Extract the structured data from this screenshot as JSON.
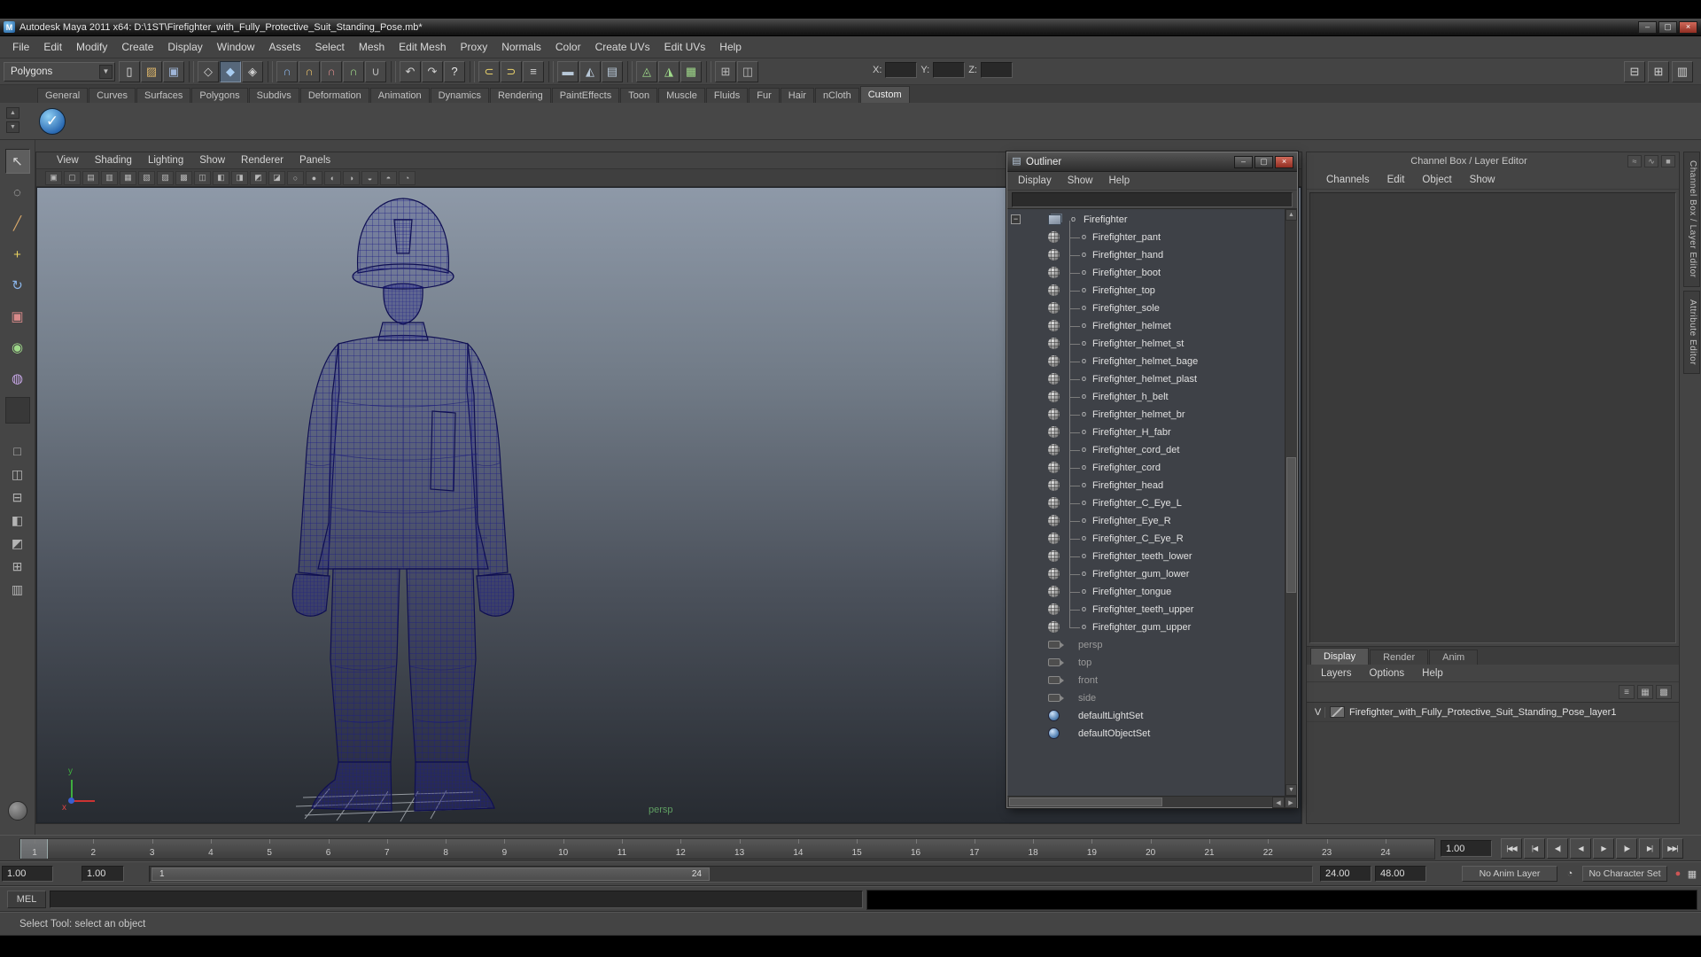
{
  "colors": {
    "wireframe": "#1d1d85",
    "viewport_top": "#8e99a8",
    "viewport_bottom": "#272b31",
    "close_button": "#912e22"
  },
  "window": {
    "title": "Autodesk Maya 2011 x64: D:\\1ST\\Firefighter_with_Fully_Protective_Suit_Standing_Pose.mb*",
    "app_icon_letter": "M",
    "controls": {
      "minimize": "–",
      "maximize": "▢",
      "close": "×"
    }
  },
  "menu_bar": {
    "items": [
      "File",
      "Edit",
      "Modify",
      "Create",
      "Display",
      "Window",
      "Assets",
      "Select",
      "Mesh",
      "Edit Mesh",
      "Proxy",
      "Normals",
      "Color",
      "Create UVs",
      "Edit UVs",
      "Help"
    ]
  },
  "toolbar": {
    "selection_mode": "Polygons",
    "dropdown_arrow": "▼",
    "groups": [
      {
        "icons": [
          {
            "name": "new-scene-icon",
            "glyph": "▯",
            "color": "#e4e4e4"
          },
          {
            "name": "open-scene-icon",
            "glyph": "▨",
            "color": "#d9b36a"
          },
          {
            "name": "save-scene-icon",
            "glyph": "▣",
            "color": "#9fb6d9"
          }
        ]
      },
      {
        "icons": [
          {
            "name": "select-hierarchy-icon",
            "glyph": "◇",
            "color": "#cfcfcf"
          },
          {
            "name": "select-object-icon",
            "glyph": "◆",
            "color": "#a8ccf0",
            "active": true
          },
          {
            "name": "select-component-icon",
            "glyph": "◈",
            "color": "#cfcfcf"
          }
        ]
      },
      {
        "icons": [
          {
            "name": "snap-to-grid-icon",
            "glyph": "∩",
            "color": "#8ab4e8"
          },
          {
            "name": "snap-to-curve-icon",
            "glyph": "∩",
            "color": "#e8c06a"
          },
          {
            "name": "snap-to-point-icon",
            "glyph": "∩",
            "color": "#d98a8a"
          },
          {
            "name": "snap-to-plane-icon",
            "glyph": "∩",
            "color": "#9fd98a"
          },
          {
            "name": "make-live-icon",
            "glyph": "∪",
            "color": "#b8b8b8"
          }
        ]
      },
      {
        "icons": [
          {
            "name": "undo-icon",
            "glyph": "↶",
            "color": "#cfcfcf"
          },
          {
            "name": "redo-icon",
            "glyph": "↷",
            "color": "#cfcfcf"
          },
          {
            "name": "quick-help-icon",
            "glyph": "?",
            "color": "#e8e8e8"
          }
        ]
      },
      {
        "icons": [
          {
            "name": "input-connections-icon",
            "glyph": "⊂",
            "color": "#e8d06a"
          },
          {
            "name": "output-connections-icon",
            "glyph": "⊃",
            "color": "#e8d06a"
          },
          {
            "name": "construction-history-icon",
            "glyph": "≡",
            "color": "#cfcfcf"
          }
        ]
      },
      {
        "icons": [
          {
            "name": "render-current-frame-icon",
            "glyph": "▬",
            "color": "#b8c8d8"
          },
          {
            "name": "ipr-render-icon",
            "glyph": "◭",
            "color": "#b8c8d8"
          },
          {
            "name": "render-settings-icon",
            "glyph": "▤",
            "color": "#b8c8d8"
          }
        ]
      },
      {
        "icons": [
          {
            "name": "paint-effects-icon",
            "glyph": "◬",
            "color": "#9fd98a"
          },
          {
            "name": "toon-outline-icon",
            "glyph": "◮",
            "color": "#9fd98a"
          },
          {
            "name": "hypershade-icon",
            "glyph": "▦",
            "color": "#9fd98a"
          }
        ]
      },
      {
        "icons": [
          {
            "name": "grid-toggle-icon",
            "glyph": "⊞",
            "color": "#b8b8b8"
          },
          {
            "name": "transform-mode-icon",
            "glyph": "◫",
            "color": "#b8b8b8"
          }
        ]
      }
    ],
    "coord_fields": {
      "x_label": "X:",
      "y_label": "Y:",
      "z_label": "Z:",
      "x_value": "",
      "y_value": "",
      "z_value": ""
    },
    "right_icons": [
      {
        "name": "layout-single-icon",
        "glyph": "⊟"
      },
      {
        "name": "layout-grid-icon",
        "glyph": "⊞"
      },
      {
        "name": "layout-panes-icon",
        "glyph": "▥"
      }
    ]
  },
  "shelf": {
    "tabs": [
      "General",
      "Curves",
      "Surfaces",
      "Polygons",
      "Subdivs",
      "Deformation",
      "Animation",
      "Dynamics",
      "Rendering",
      "PaintEffects",
      "Toon",
      "Muscle",
      "Fluids",
      "Fur",
      "Hair",
      "nCloth",
      "Custom"
    ],
    "active_tab": "Custom",
    "nav_up": "▲",
    "nav_down": "▼",
    "items": [
      {
        "name": "custom-shelf-sphere-check-icon",
        "glyph": "✓"
      }
    ]
  },
  "toolbox": {
    "tools": [
      {
        "name": "select-tool",
        "glyph": "↖",
        "active": true
      },
      {
        "name": "lasso-select-tool",
        "glyph": "◌"
      },
      {
        "name": "paint-select-tool",
        "glyph": "╱",
        "color": "#d8a86a"
      },
      {
        "name": "move-tool",
        "glyph": "+",
        "color": "#e8d060"
      },
      {
        "name": "rotate-tool",
        "glyph": "↻",
        "color": "#8ab4e8"
      },
      {
        "name": "scale-tool",
        "glyph": "▣",
        "color": "#d98a8a"
      },
      {
        "name": "universal-manipulator-tool",
        "glyph": "◉",
        "color": "#9fd98a"
      },
      {
        "name": "soft-modification-tool",
        "glyph": "◍",
        "color": "#c8a8e8"
      },
      {
        "name": "last-tool-slot",
        "glyph": "",
        "slot": true
      }
    ],
    "layouts": [
      {
        "name": "single-pane-layout",
        "glyph": "□"
      },
      {
        "name": "two-pane-side-layout",
        "glyph": "◫"
      },
      {
        "name": "two-pane-stacked-layout",
        "glyph": "⊟"
      },
      {
        "name": "three-pane-left-layout",
        "glyph": "◧"
      },
      {
        "name": "three-pane-bottom-layout",
        "glyph": "◩"
      },
      {
        "name": "four-pane-layout",
        "glyph": "⊞"
      },
      {
        "name": "outliner-persp-layout",
        "glyph": "▥"
      }
    ]
  },
  "viewport": {
    "menus": [
      "View",
      "Shading",
      "Lighting",
      "Show",
      "Renderer",
      "Panels"
    ],
    "toolbar_icons": [
      {
        "name": "select-camera-icon",
        "glyph": "▣"
      },
      {
        "name": "lock-camera-icon",
        "glyph": "▢"
      },
      {
        "name": "camera-attributes-icon",
        "glyph": "▤"
      },
      {
        "name": "bookmark-icon",
        "glyph": "▥"
      },
      {
        "name": "image-plane-icon",
        "glyph": "▦"
      },
      {
        "name": "two-d-pan-zoom-icon",
        "glyph": "▧"
      },
      {
        "name": "grid-icon",
        "glyph": "▨"
      },
      {
        "name": "film-gate-icon",
        "glyph": "▩"
      },
      {
        "name": "resolution-gate-icon",
        "glyph": "◫"
      },
      {
        "name": "gate-mask-icon",
        "glyph": "◧"
      },
      {
        "name": "field-chart-icon",
        "glyph": "◨"
      },
      {
        "name": "safe-action-icon",
        "glyph": "◩"
      },
      {
        "name": "safe-title-icon",
        "glyph": "◪"
      },
      {
        "name": "wireframe-mode-icon",
        "glyph": "○"
      },
      {
        "name": "shaded-mode-icon",
        "glyph": "●"
      },
      {
        "name": "textured-mode-icon",
        "glyph": "◐"
      },
      {
        "name": "use-all-lights-icon",
        "glyph": "◑"
      },
      {
        "name": "shadows-icon",
        "glyph": "◒"
      },
      {
        "name": "xray-icon",
        "glyph": "◓"
      },
      {
        "name": "isolate-select-icon",
        "glyph": "◔"
      }
    ],
    "camera_label": "persp",
    "axis_y_label": "y",
    "axis_x_label": "x"
  },
  "outliner": {
    "title": "Outliner",
    "window_icon": "▤",
    "controls": {
      "minimize": "–",
      "maximize": "▢",
      "close": "×"
    },
    "menus": [
      "Display",
      "Show",
      "Help"
    ],
    "filter_value": "",
    "tree": {
      "root": "Firefighter",
      "root_expand": "−",
      "shape_expand": "+",
      "shape_expand_row": "Firefighter_C_Eye_L",
      "connector": "o",
      "children": [
        "Firefighter_pant",
        "Firefighter_hand",
        "Firefighter_boot",
        "Firefighter_top",
        "Firefighter_sole",
        "Firefighter_helmet",
        "Firefighter_helmet_st",
        "Firefighter_helmet_bage",
        "Firefighter_helmet_plast",
        "Firefighter_h_belt",
        "Firefighter_helmet_br",
        "Firefighter_H_fabr",
        "Firefighter_cord_det",
        "Firefighter_cord",
        "Firefighter_head",
        "Firefighter_C_Eye_L",
        "Firefighter_Eye_R",
        "Firefighter_C_Eye_R",
        "Firefighter_teeth_lower",
        "Firefighter_gum_lower",
        "Firefighter_tongue",
        "Firefighter_teeth_upper",
        "Firefighter_gum_upper"
      ],
      "cameras": [
        "persp",
        "top",
        "front",
        "side"
      ],
      "sets": [
        "defaultLightSet",
        "defaultObjectSet"
      ]
    },
    "scroll_up": "▲",
    "scroll_down": "▼",
    "scroll_left": "◀",
    "scroll_right": "▶"
  },
  "channel_box": {
    "panel_title": "Channel Box / Layer Editor",
    "corner_icons": [
      {
        "name": "channel-speed-icon",
        "glyph": "≈"
      },
      {
        "name": "channel-hyperbolic-icon",
        "glyph": "∿"
      },
      {
        "name": "channel-lock-icon",
        "glyph": "■"
      }
    ],
    "menus": [
      "Channels",
      "Edit",
      "Object",
      "Show"
    ],
    "layer_editor": {
      "tabs": [
        "Display",
        "Render",
        "Anim"
      ],
      "active_tab": "Display",
      "menus": [
        "Layers",
        "Options",
        "Help"
      ],
      "icons": [
        {
          "name": "sort-layers-icon",
          "glyph": "≡"
        },
        {
          "name": "new-empty-layer-icon",
          "glyph": "▦"
        },
        {
          "name": "new-layer-from-selected-icon",
          "glyph": "▩"
        }
      ],
      "layers": [
        {
          "visible": "V",
          "name": "Firefighter_with_Fully_Protective_Suit_Standing_Pose_layer1"
        }
      ]
    },
    "side_tabs": [
      "Channel Box / Layer Editor",
      "Attribute Editor"
    ]
  },
  "timeline": {
    "frame_labels": [
      "1",
      "2",
      "3",
      "4",
      "5",
      "6",
      "7",
      "8",
      "9",
      "10",
      "11",
      "12",
      "13",
      "14",
      "15",
      "16",
      "17",
      "18",
      "19",
      "20",
      "21",
      "22",
      "23",
      "24"
    ],
    "current_frame": "1.00",
    "playback": [
      {
        "name": "go-to-start-button",
        "glyph": "|◀◀"
      },
      {
        "name": "step-back-key-button",
        "glyph": "|◀"
      },
      {
        "name": "step-back-frame-button",
        "glyph": "◀|"
      },
      {
        "name": "play-backward-button",
        "glyph": "◀"
      },
      {
        "name": "play-forward-button",
        "glyph": "▶"
      },
      {
        "name": "step-forward-frame-button",
        "glyph": "|▶"
      },
      {
        "name": "step-forward-key-button",
        "glyph": "▶|"
      },
      {
        "name": "go-to-end-button",
        "glyph": "▶▶|"
      }
    ],
    "range": {
      "anim_start": "1.00",
      "playback_start": "1.00",
      "playback_end": "24.00",
      "anim_end": "48.00",
      "active_start_label": "1",
      "active_end_label": "24"
    },
    "anim_layer_menu": "No Anim Layer",
    "character_set_menu": "No Character Set",
    "extra_icons": [
      {
        "name": "stopwatch-icon",
        "glyph": "◔"
      },
      {
        "name": "auto-key-icon",
        "glyph": "●"
      },
      {
        "name": "anim-preferences-icon",
        "glyph": "▦"
      }
    ]
  },
  "command_line": {
    "label": "MEL",
    "input_value": ""
  },
  "help_line": {
    "text": "Select Tool: select an object"
  }
}
